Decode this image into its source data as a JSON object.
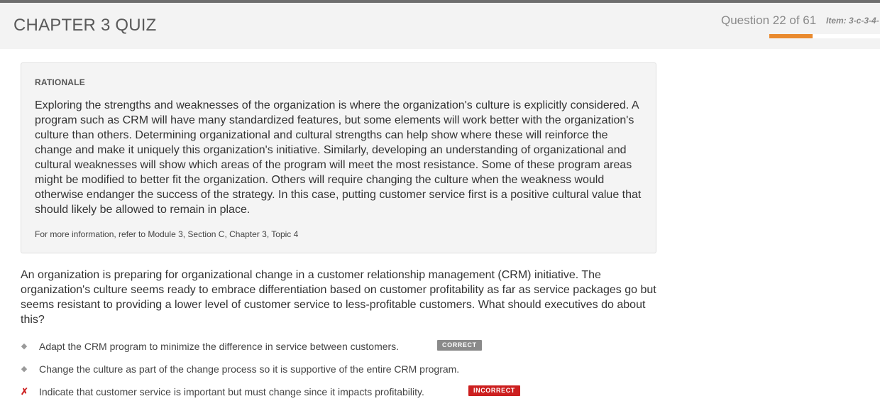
{
  "header": {
    "title": "CHAPTER 3 QUIZ",
    "question_counter": "Question 22 of 61",
    "item_id": "Item: 3-c-3-4-",
    "progress_fraction": 0.393,
    "accent_color": "#e98a2e"
  },
  "rationale": {
    "heading": "RATIONALE",
    "body": "Exploring the strengths and weaknesses of the organization is where the organization's culture is explicitly considered. A program such as CRM will have many standardized features, but some elements will work better with the organization's culture than others. Determining organizational and cultural strengths can help show where these will reinforce the change and make it uniquely this organization's initiative. Similarly, developing an understanding of organizational and cultural weaknesses will show which areas of the program will meet the most resistance. Some of these program areas might be modified to better fit the organization. Others will require changing the culture when the weakness would otherwise endanger the success of the strategy. In this case, putting customer service first is a positive cultural value that should likely be allowed to remain in place.",
    "reference": "For more information, refer to Module 3, Section C, Chapter 3, Topic 4"
  },
  "question": {
    "text": "An organization is preparing for organizational change in a customer relationship management (CRM) initiative. The organization's culture seems ready to embrace differentiation based on customer profitability as far as service packages go but seems resistant to providing a lower level of customer service to less-profitable customers. What should executives do about this?"
  },
  "answers": [
    {
      "marker": "diamond-icon",
      "text": "Adapt the CRM program to minimize the difference in service between customers.",
      "badge": "CORRECT",
      "badge_color": "#8a8a8a"
    },
    {
      "marker": "diamond-icon",
      "text": "Change the culture as part of the change process so it is supportive of the entire CRM program.",
      "badge": ""
    },
    {
      "marker": "x-mark-icon",
      "text": "Indicate that customer service is important but must change since it impacts profitability.",
      "badge": "INCORRECT",
      "badge_color": "#cc1f1f"
    }
  ]
}
